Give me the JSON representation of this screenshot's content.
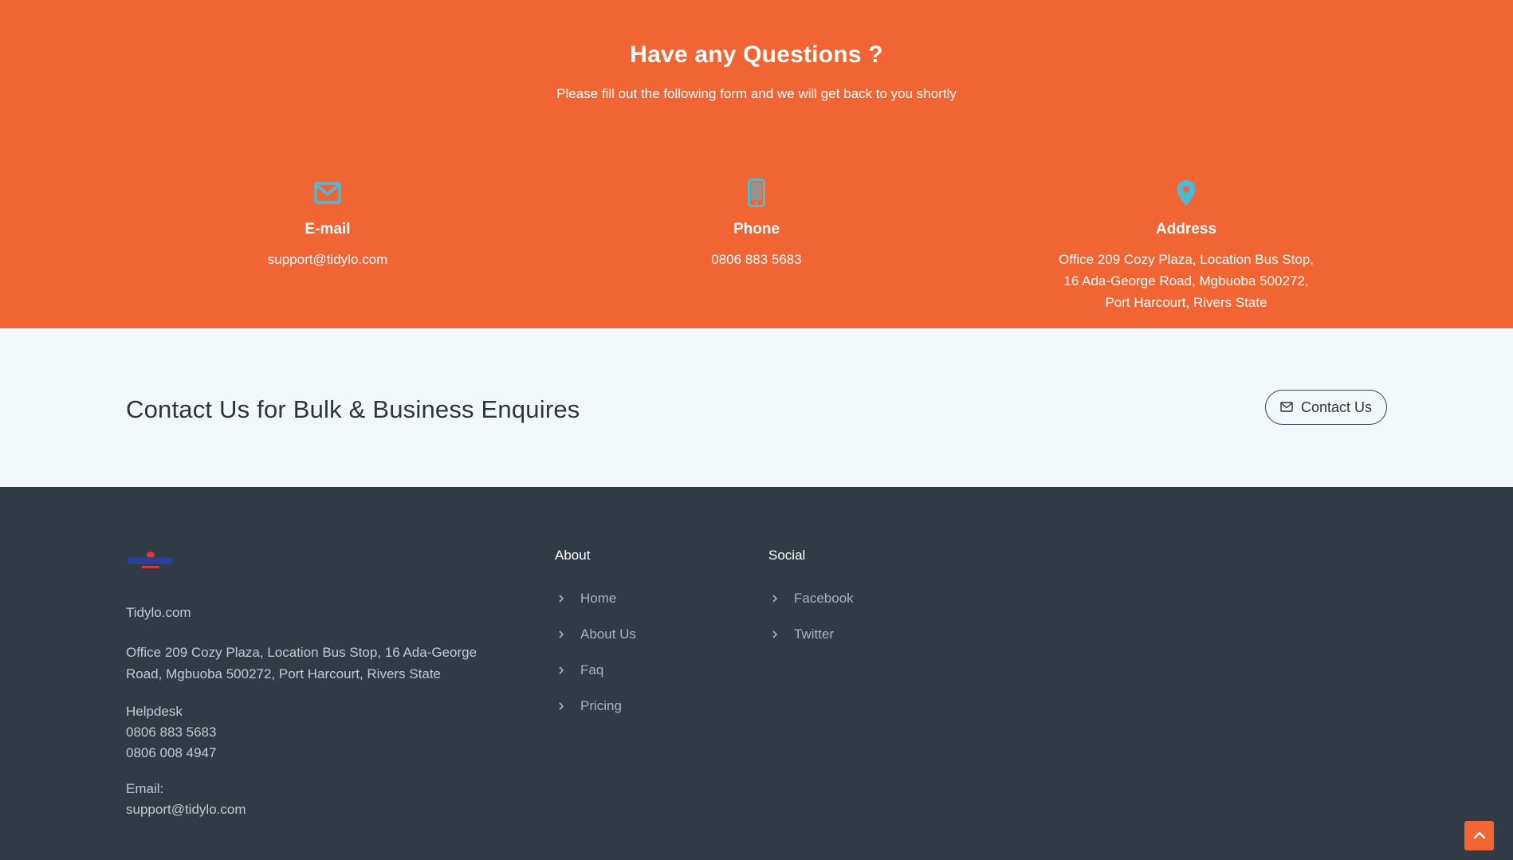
{
  "questions": {
    "title": "Have any Questions ?",
    "subtitle": "Please fill out the following form and we will get back to you shortly",
    "background": "#f16433",
    "icon_color": "#4fb8d3",
    "email": {
      "icon": "envelope-icon",
      "label": "E-mail",
      "value": "support@tidylo.com"
    },
    "phone": {
      "icon": "mobile-phone-icon",
      "label": "Phone",
      "value": "0806 883 5683"
    },
    "address": {
      "icon": "map-pin-icon",
      "label": "Address",
      "value": "Office 209 Cozy Plaza, Location Bus Stop,\n16 Ada-George Road, Mgbuoba 500272,\nPort Harcourt, Rivers State"
    }
  },
  "enquiries": {
    "title": "Contact Us for Bulk & Business Enquires",
    "button_label": "Contact Us",
    "button_icon": "envelope-icon"
  },
  "footer": {
    "background": "#303b46",
    "brand_name": "Tidylo.com",
    "address": "Office 209 Cozy Plaza, Location Bus Stop, 16 Ada-George Road, Mgbuoba 500272, Port Harcourt, Rivers State",
    "helpdesk_label": "Helpdesk",
    "phone_1": "0806 883 5683",
    "phone_2": "0806 008 4947",
    "email_label": "Email:",
    "email": "support@tidylo.com",
    "about": {
      "title": "About",
      "links": [
        "Home",
        "About Us",
        "Faq",
        "Pricing"
      ]
    },
    "social": {
      "title": "Social",
      "links": [
        "Facebook",
        "Twitter"
      ]
    }
  },
  "scroll_top": {
    "icon": "chevron-up-icon",
    "color": "#f16433"
  }
}
